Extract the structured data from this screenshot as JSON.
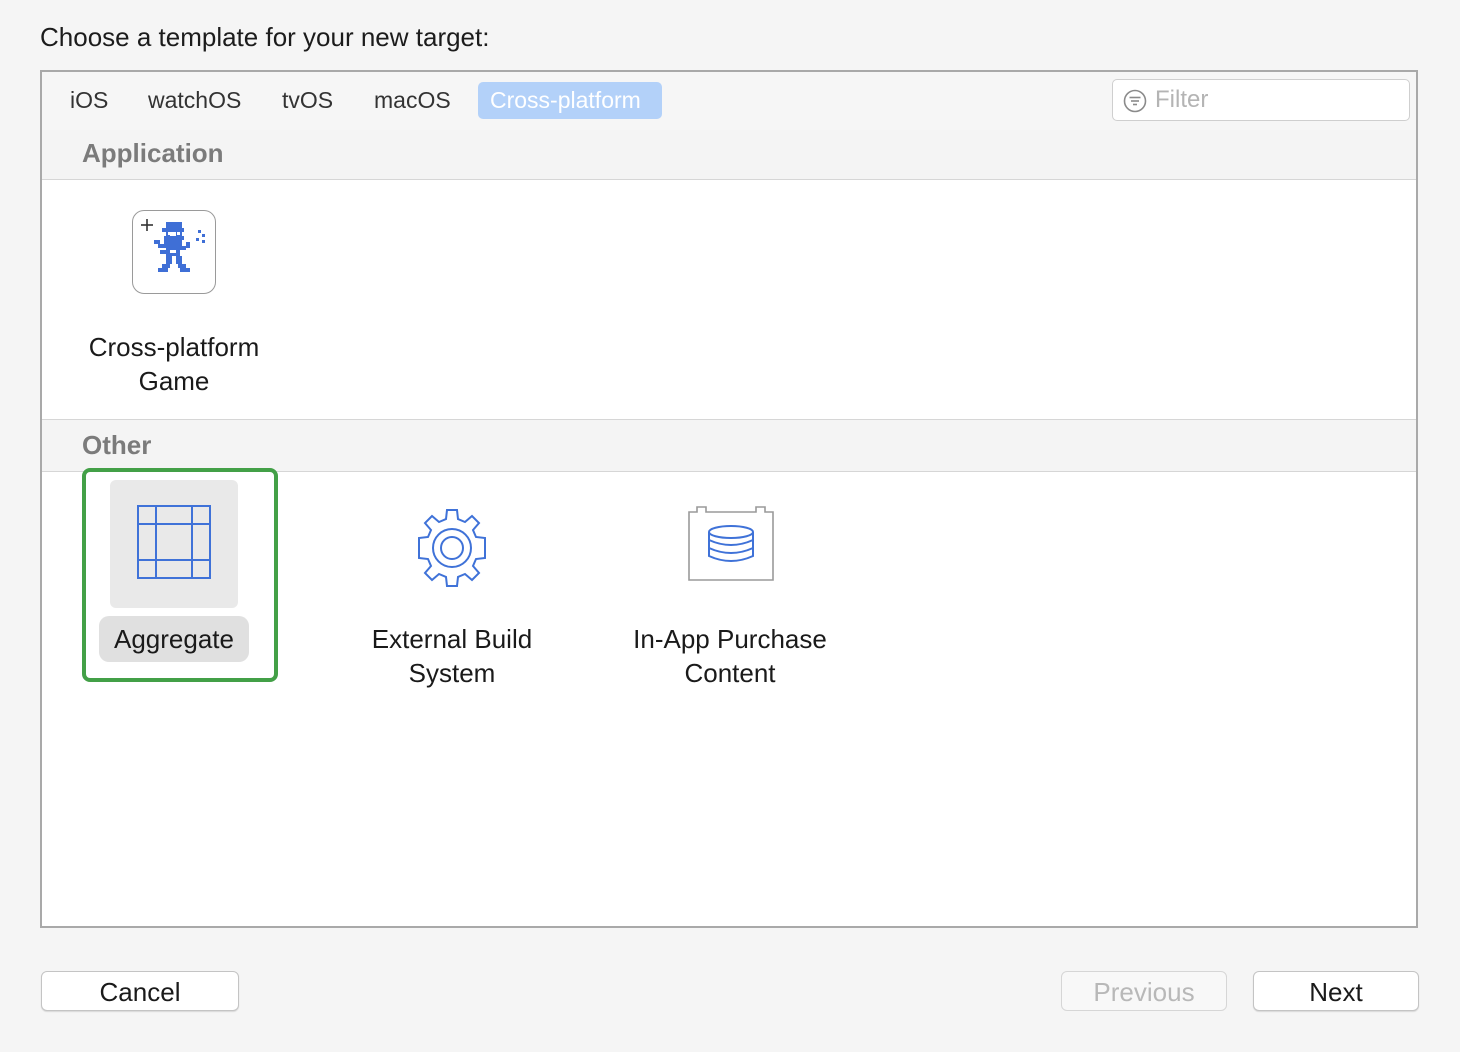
{
  "dialog": {
    "heading": "Choose a template for your new target:"
  },
  "tabs": [
    {
      "label": "iOS",
      "selected": false
    },
    {
      "label": "watchOS",
      "selected": false
    },
    {
      "label": "tvOS",
      "selected": false
    },
    {
      "label": "macOS",
      "selected": false
    },
    {
      "label": "Cross-platform",
      "selected": true
    }
  ],
  "filter": {
    "placeholder": "Filter",
    "value": "",
    "icon": "filter-icon"
  },
  "sections": [
    {
      "title": "Application",
      "templates": [
        {
          "line1": "Cross-platform",
          "line2": "Game",
          "icon": "game-sprite-icon"
        }
      ]
    },
    {
      "title": "Other",
      "templates": [
        {
          "line1": "Aggregate",
          "line2": "",
          "icon": "aggregate-icon",
          "selected": true
        },
        {
          "line1": "External Build",
          "line2": "System",
          "icon": "gear-icon"
        },
        {
          "line1": "In-App Purchase",
          "line2": "Content",
          "icon": "database-box-icon"
        }
      ]
    }
  ],
  "buttons": {
    "cancel": "Cancel",
    "previous": "Previous",
    "next": "Next"
  },
  "colors": {
    "accent_blue": "#3f72d8",
    "tab_selected_bg": "#b3d1f9",
    "selection_highlight": "#43a047"
  }
}
